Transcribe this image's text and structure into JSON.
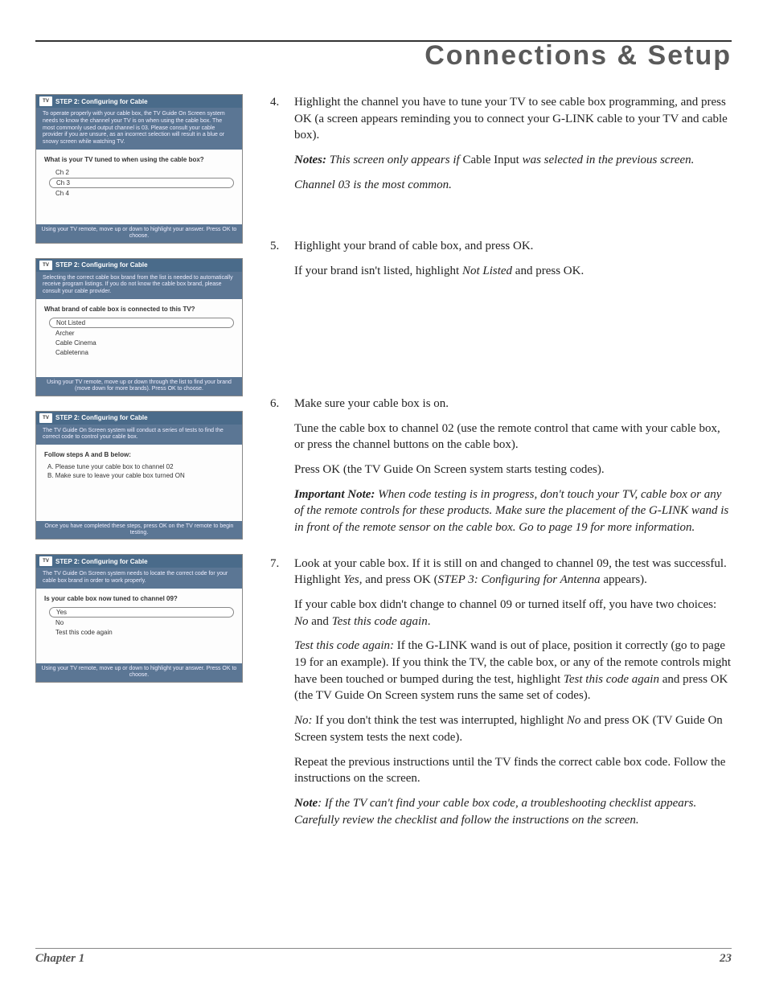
{
  "header": {
    "title": "Connections & Setup"
  },
  "footer": {
    "chapter": "Chapter 1",
    "page": "23"
  },
  "screenshots": {
    "s1": {
      "title": "STEP 2: Configuring for Cable",
      "intro": "To operate properly with your cable box, the TV Guide On Screen system needs to know the channel your TV is on when using the cable box. The most commonly used output channel is 03. Please consult your cable provider if you are unsure, as an incorrect selection will result in a blue or snowy screen while watching TV.",
      "question": "What is your TV tuned to when using the cable box?",
      "options": [
        "Ch 2",
        "Ch 3",
        "Ch 4"
      ],
      "selected": 1,
      "foot": "Using your TV remote, move up or down to highlight your answer.  Press OK to choose."
    },
    "s2": {
      "title": "STEP 2: Configuring for Cable",
      "intro": "Selecting the correct cable box brand from the list is needed to automatically receive program listings. If you do not know the cable box brand, please consult your cable provider.",
      "question": "What brand of cable box is connected to this TV?",
      "options": [
        "Not Listed",
        "Archer",
        "Cable Cinema",
        "Cabletenna"
      ],
      "selected": 0,
      "foot": "Using your TV remote, move up or down through the list to find your brand (move down for more brands). Press OK to choose."
    },
    "s3": {
      "title": "STEP 2: Configuring for Cable",
      "intro": "The TV Guide On Screen system will conduct a series of tests to find the correct code to control your cable box.",
      "question": "Follow steps A and B below:",
      "stepA": "A.  Please tune your cable box to channel 02",
      "stepB": "B.  Make sure to leave your cable box turned ON",
      "foot": "Once you have completed these steps, press OK on the TV remote to begin testing."
    },
    "s4": {
      "title": "STEP 2: Configuring for Cable",
      "intro": "The TV Guide On Screen system needs to locate the correct code for your cable box brand in order to work properly.",
      "question": "Is your cable box now tuned to channel 09?",
      "options": [
        "Yes",
        "No",
        "Test this code again"
      ],
      "selected": 0,
      "foot": "Using your TV remote, move up or down to highlight your answer.  Press OK to choose."
    }
  },
  "steps": {
    "n4": "4.",
    "p4a_pre": "Highlight the channel you have to tune your TV to see cable box programming, and press OK (a screen appears reminding you to connect your G-LINK cable to your TV and cable box).",
    "p4_notes_label": "Notes:",
    "p4_notes_1a": " This screen only appears if ",
    "p4_notes_1b": "Cable Input",
    "p4_notes_1c": " was selected in the previous screen.",
    "p4_notes_2": "Channel 03 is the most common.",
    "n5": "5.",
    "p5a": "Highlight your brand of cable box, and press OK.",
    "p5b_pre": "If your brand isn't listed, highlight ",
    "p5b_em": "Not Listed",
    "p5b_post": " and press OK.",
    "n6": "6.",
    "p6a": "Make sure your cable box is on.",
    "p6b": "Tune the cable box to channel 02 (use the remote control that came with your cable box, or press the channel buttons on the cable box).",
    "p6c": "Press OK (the TV Guide On Screen system starts testing codes).",
    "p6_imp_label": "Important Note:",
    "p6_imp_body": " When code testing is in progress, don't touch your TV, cable box or any of the remote controls for these products. Make sure the placement of the G-LINK wand is in front of the remote sensor on the cable box. Go to page 19 for more information.",
    "n7": "7.",
    "p7a_1": "Look at your cable box. If it is still on and changed to channel 09, the test was successful. Highlight ",
    "p7a_yes": "Yes,",
    "p7a_2": " and press OK (",
    "p7a_step3": "STEP 3: Configuring for Antenna",
    "p7a_3": " appears).",
    "p7b_1": "If your cable box didn't change to channel 09 or turned itself off, you have two choices: ",
    "p7b_no": "No",
    "p7b_and": " and ",
    "p7b_test": "Test this code again",
    "p7b_end": ".",
    "p7c_label": "Test this code again:",
    "p7c_1": " If the G-LINK wand is out of place, position it correctly (go to page 19 for an example). If you think the TV, the cable box, or any of the remote controls might have been touched or bumped during the test, highlight ",
    "p7c_em": "Test this code again",
    "p7c_2": " and press OK (the TV Guide On Screen system runs the same set of codes).",
    "p7d_label": "No:",
    "p7d_1": " If you don't think the test was interrupted, highlight ",
    "p7d_no": "No",
    "p7d_2": " and press OK (TV Guide On Screen system tests the next code).",
    "p7e": "Repeat the previous instructions until the TV finds the correct cable box code. Follow the instructions on the screen.",
    "p7f_label": "Note",
    "p7f_body": ": If the TV can't find your cable box code, a troubleshooting checklist appears. Carefully review the checklist and follow the instructions on the screen."
  }
}
